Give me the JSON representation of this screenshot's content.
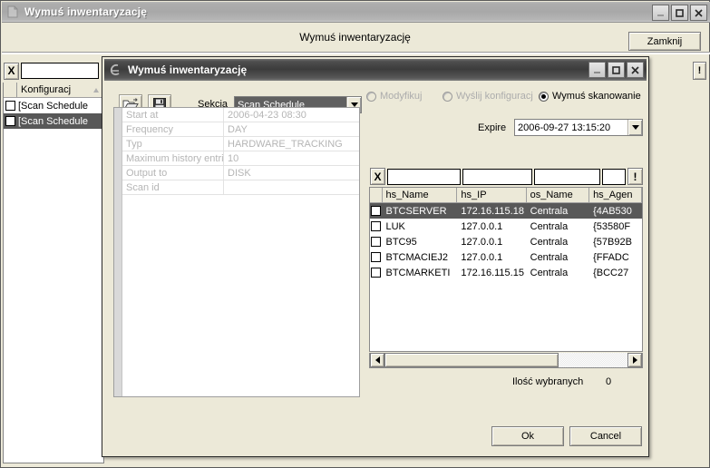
{
  "background_window": {
    "title": "Wymuś inwentaryzację",
    "icon": "document-icon",
    "header_label": "Wymuś inwentaryzację",
    "close_button": "Zamknij",
    "window_buttons": {
      "minimize": "minimize-icon",
      "maximize": "maximize-icon",
      "close": "close-icon"
    },
    "filter": {
      "clear_label": "X",
      "value": "",
      "placeholder": ""
    },
    "bang_button": "!",
    "list": {
      "header": "Konfiguracj",
      "sort_indicator": "sort-ascending-icon",
      "rows": [
        {
          "label": "[Scan Schedule",
          "checked": false,
          "selected": false
        },
        {
          "label": "[Scan Schedule",
          "checked": false,
          "selected": true
        }
      ]
    }
  },
  "dialog": {
    "title": "Wymuś inwentaryzację",
    "icon": "app-icon",
    "window_buttons": {
      "minimize": "minimize-icon",
      "maximize": "maximize-icon",
      "close": "close-icon"
    },
    "toolbar": {
      "open_icon": "open-folder-icon",
      "save_icon": "save-floppy-icon"
    },
    "section": {
      "label": "Sekcja",
      "value": "Scan Schedule",
      "arrow_icon": "chevron-down-icon"
    },
    "properties": [
      {
        "key": "Start at",
        "value": "2006-04-23 08:30"
      },
      {
        "key": "Frequency",
        "value": "DAY"
      },
      {
        "key": "Typ",
        "value": "HARDWARE_TRACKING"
      },
      {
        "key": "Maximum history entri",
        "value": "10"
      },
      {
        "key": "Output to",
        "value": "DISK"
      },
      {
        "key": "Scan id",
        "value": ""
      }
    ],
    "modes": [
      {
        "label": "Modyfikuj",
        "selected": false,
        "enabled": false
      },
      {
        "label": "Wyślij konfiguracj",
        "selected": false,
        "enabled": false
      },
      {
        "label": "Wymuś skanowanie",
        "selected": true,
        "enabled": true
      }
    ],
    "expire": {
      "label": "Expire",
      "value": "2006-09-27 13:15:20",
      "arrow_icon": "chevron-down-icon"
    },
    "grid_filter": {
      "clear_label": "X",
      "values": [
        "",
        "",
        "",
        ""
      ],
      "apply_label": "!"
    },
    "grid": {
      "columns": [
        "hs_Name",
        "hs_IP",
        "os_Name",
        "hs_Agen"
      ],
      "rows": [
        {
          "checked": false,
          "selected": true,
          "cells": [
            "BTCSERVER",
            "172.16.115.18",
            "Centrala",
            "{4AB530"
          ]
        },
        {
          "checked": false,
          "selected": false,
          "cells": [
            "LUK",
            "127.0.0.1",
            "Centrala",
            "{53580F"
          ]
        },
        {
          "checked": false,
          "selected": false,
          "cells": [
            "BTC95",
            "127.0.0.1",
            "Centrala",
            "{57B92B"
          ]
        },
        {
          "checked": false,
          "selected": false,
          "cells": [
            "BTCMACIEJ2",
            "127.0.0.1",
            "Centrala",
            "{FFADC"
          ]
        },
        {
          "checked": false,
          "selected": false,
          "cells": [
            "BTCMARKETI",
            "172.16.115.15",
            "Centrala",
            "{BCC27"
          ]
        }
      ]
    },
    "scrollbar": {
      "left_icon": "arrow-left-icon",
      "right_icon": "arrow-right-icon"
    },
    "selected_count": {
      "label": "Ilość wybranych",
      "value": "0"
    },
    "buttons": {
      "ok": "Ok",
      "cancel": "Cancel"
    }
  }
}
